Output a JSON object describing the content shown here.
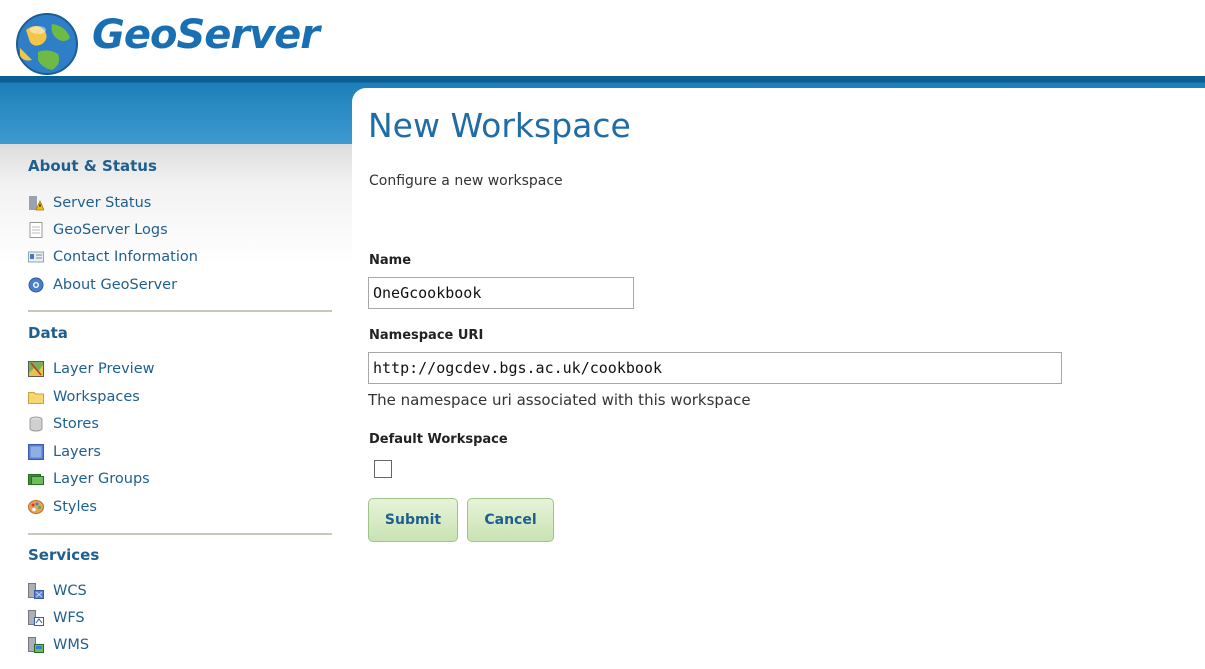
{
  "header": {
    "brand": "GeoServer"
  },
  "sidebar": {
    "sections": [
      {
        "title": "About & Status",
        "items": [
          {
            "label": "Server Status",
            "icon": "server-status-icon"
          },
          {
            "label": "GeoServer Logs",
            "icon": "document-icon"
          },
          {
            "label": "Contact Information",
            "icon": "contact-card-icon"
          },
          {
            "label": "About GeoServer",
            "icon": "info-globe-icon"
          }
        ]
      },
      {
        "title": "Data",
        "items": [
          {
            "label": "Layer Preview",
            "icon": "map-preview-icon"
          },
          {
            "label": "Workspaces",
            "icon": "folder-icon"
          },
          {
            "label": "Stores",
            "icon": "database-icon"
          },
          {
            "label": "Layers",
            "icon": "layer-icon"
          },
          {
            "label": "Layer Groups",
            "icon": "layer-group-icon"
          },
          {
            "label": "Styles",
            "icon": "palette-icon"
          }
        ]
      },
      {
        "title": "Services",
        "items": [
          {
            "label": "WCS",
            "icon": "wcs-service-icon"
          },
          {
            "label": "WFS",
            "icon": "wfs-service-icon"
          },
          {
            "label": "WMS",
            "icon": "wms-service-icon"
          }
        ]
      }
    ]
  },
  "main": {
    "title": "New Workspace",
    "description": "Configure a new workspace",
    "form": {
      "name_label": "Name",
      "name_value": "OneGcookbook",
      "uri_label": "Namespace URI",
      "uri_value": "http://ogcdev.bgs.ac.uk/cookbook",
      "uri_hint": "The namespace uri associated with this workspace",
      "default_label": "Default Workspace",
      "default_checked": false,
      "submit_label": "Submit",
      "cancel_label": "Cancel"
    }
  },
  "colors": {
    "brand_blue": "#1a6fb3",
    "link_blue": "#1f5f8f",
    "header_band": "#1d7fb8",
    "button_green": "#c9e3b2"
  }
}
